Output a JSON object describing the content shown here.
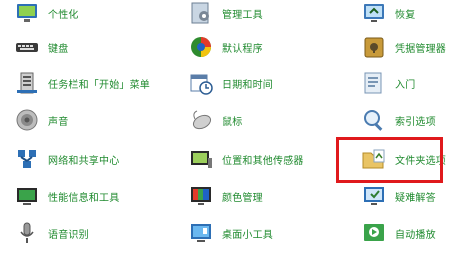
{
  "panel": {
    "items": [
      {
        "id": "personalization",
        "label": "个性化",
        "icon": "personalization-icon"
      },
      {
        "id": "admin-tools",
        "label": "管理工具",
        "icon": "admin-tools-icon"
      },
      {
        "id": "recovery",
        "label": "恢复",
        "icon": "recovery-icon"
      },
      {
        "id": "keyboard",
        "label": "键盘",
        "icon": "keyboard-icon"
      },
      {
        "id": "default-programs",
        "label": "默认程序",
        "icon": "default-programs-icon"
      },
      {
        "id": "credential-manager",
        "label": "凭据管理器",
        "icon": "credential-manager-icon"
      },
      {
        "id": "taskbar-start",
        "label": "任务栏和「开始」菜单",
        "icon": "taskbar-icon"
      },
      {
        "id": "date-time",
        "label": "日期和时间",
        "icon": "calendar-clock-icon"
      },
      {
        "id": "getting-started",
        "label": "入门",
        "icon": "getting-started-icon"
      },
      {
        "id": "sound",
        "label": "声音",
        "icon": "speaker-icon"
      },
      {
        "id": "mouse",
        "label": "鼠标",
        "icon": "mouse-icon"
      },
      {
        "id": "indexing",
        "label": "索引选项",
        "icon": "indexing-icon"
      },
      {
        "id": "network-sharing",
        "label": "网络和共享中心",
        "icon": "network-icon"
      },
      {
        "id": "location-sensors",
        "label": "位置和其他传感器",
        "icon": "location-sensor-icon"
      },
      {
        "id": "folder-options",
        "label": "文件夹选项",
        "icon": "folder-options-icon"
      },
      {
        "id": "performance",
        "label": "性能信息和工具",
        "icon": "performance-icon"
      },
      {
        "id": "color-management",
        "label": "颜色管理",
        "icon": "color-management-icon"
      },
      {
        "id": "troubleshooting",
        "label": "疑难解答",
        "icon": "troubleshooting-icon"
      },
      {
        "id": "speech",
        "label": "语音识别",
        "icon": "microphone-icon"
      },
      {
        "id": "desktop-gadgets",
        "label": "桌面小工具",
        "icon": "gadgets-icon"
      },
      {
        "id": "autoplay",
        "label": "自动播放",
        "icon": "autoplay-icon"
      }
    ]
  },
  "highlight": {
    "target": "folder-options",
    "color": "#e0191c"
  },
  "colors": {
    "link_text": "#1f8a2e",
    "background": "#ffffff"
  }
}
